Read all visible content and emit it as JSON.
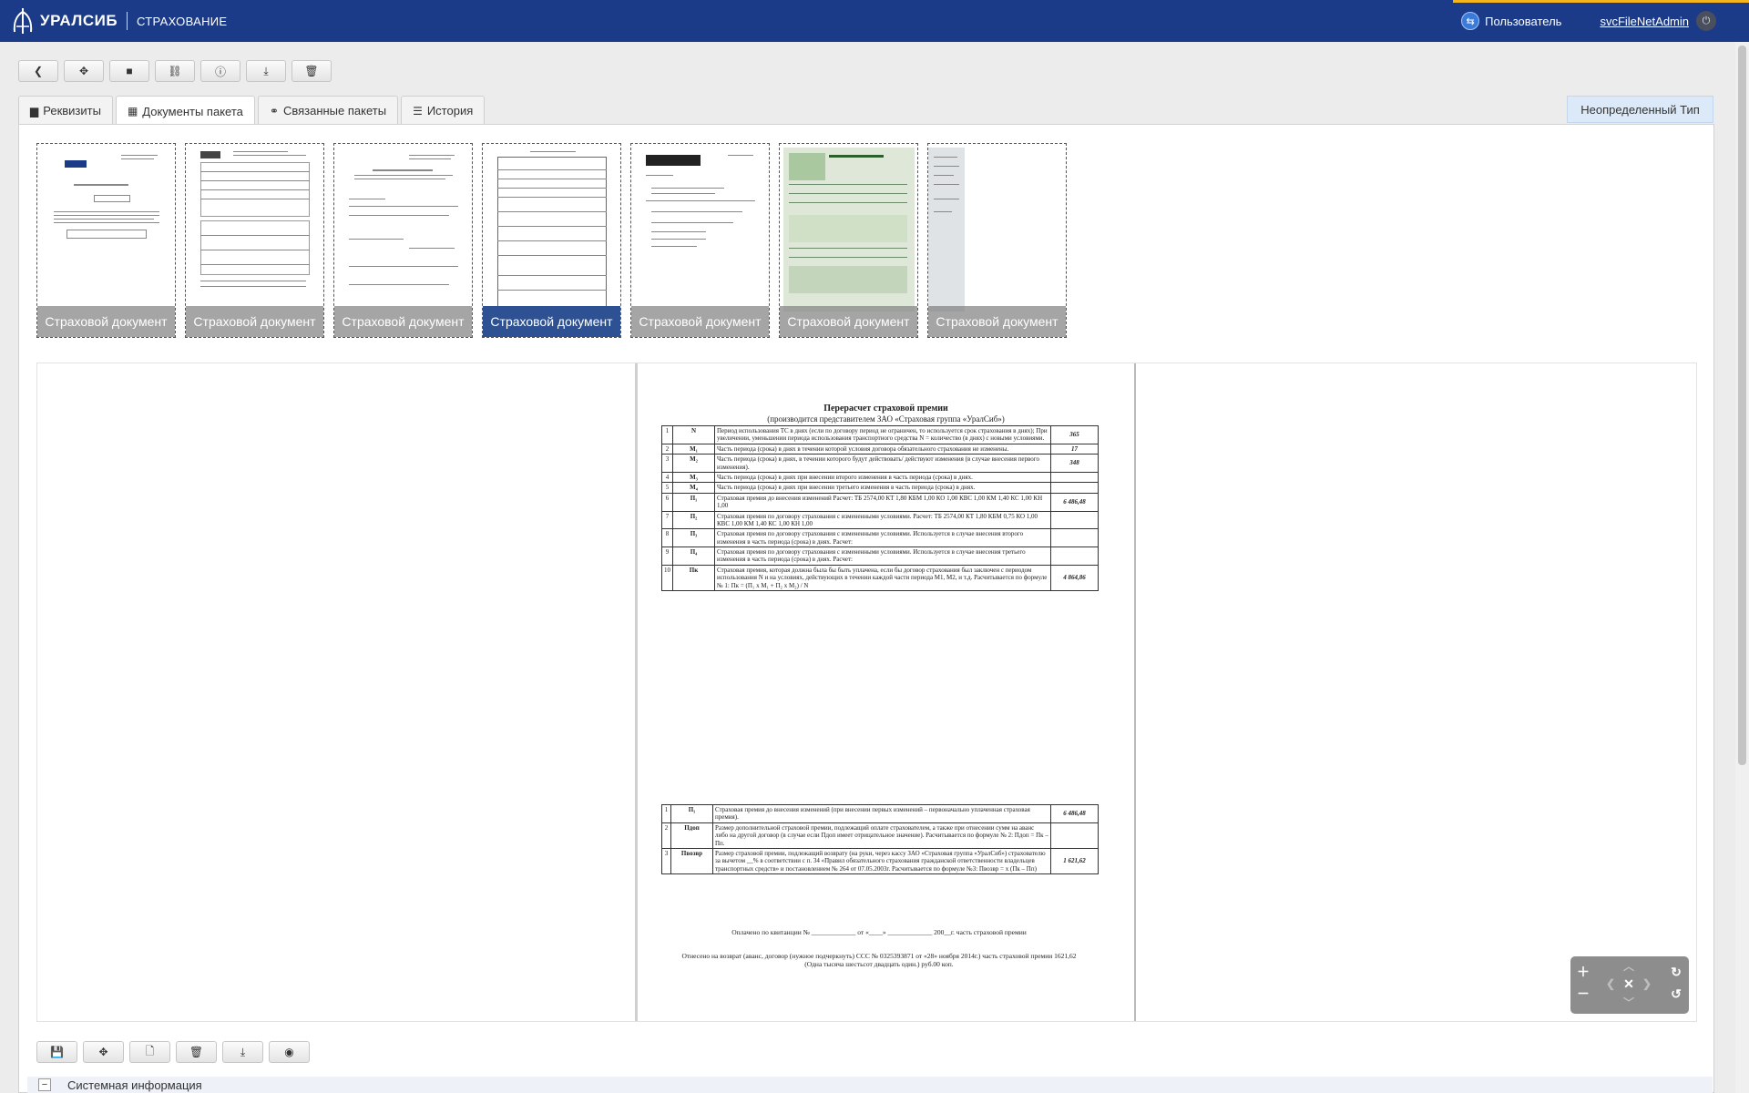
{
  "header": {
    "brand": "УРАЛСИБ",
    "section": "СТРАХОВАНИЕ",
    "role_label": "Пользователь",
    "username": "svcFileNetAdmin"
  },
  "toolbar": {
    "buttons": [
      "back-icon",
      "move-icon",
      "folder-icon",
      "link-icon",
      "info-icon",
      "download-icon",
      "trash-icon"
    ]
  },
  "tabs": [
    {
      "label": "Реквизиты",
      "icon": "book-icon",
      "active": false
    },
    {
      "label": "Документы пакета",
      "icon": "grid-icon",
      "active": true
    },
    {
      "label": "Связанные пакеты",
      "icon": "link-icon",
      "active": false
    },
    {
      "label": "История",
      "icon": "list-icon",
      "active": false
    }
  ],
  "type_badge": "Неопределенный Тип",
  "thumbnails": [
    {
      "caption": "Страховой документ",
      "selected": false
    },
    {
      "caption": "Страховой документ",
      "selected": false
    },
    {
      "caption": "Страховой документ",
      "selected": false
    },
    {
      "caption": "Страховой документ",
      "selected": true
    },
    {
      "caption": "Страховой документ",
      "selected": false
    },
    {
      "caption": "Страховой документ",
      "selected": false
    },
    {
      "caption": "Страховой документ",
      "selected": false
    }
  ],
  "document": {
    "title": "Перерасчет страховой премии",
    "subtitle": "(производится представителем ЗАО «Страховая группа «УралСиб»)",
    "rows": [
      {
        "n": "1",
        "sym": "N",
        "text": "Период использования ТС в днях (если по договору период не ограничен, то используется срок страхования в днях); При увеличении, уменьшении периода использования транспортного средства N = количество (в днях) с новыми условиями.",
        "val": "365"
      },
      {
        "n": "2",
        "sym": "M₁",
        "text": "Часть периода (срока) в днях в течении которой условия договора обязательного страхования не изменены.",
        "val": "17"
      },
      {
        "n": "3",
        "sym": "M₂",
        "text": "Часть периода (срока) в днях, в течении которого будут действовать/ действуют изменения (в случае внесения первого изменения).",
        "val": "348"
      },
      {
        "n": "4",
        "sym": "M₃",
        "text": "Часть периода (срока) в днях при внесении второго изменения в часть периода (срока) в днях.",
        "val": ""
      },
      {
        "n": "5",
        "sym": "M₄",
        "text": "Часть периода (срока) в днях при внесении третьего изменения в часть периода (срока) в днях.",
        "val": ""
      },
      {
        "n": "6",
        "sym": "П₁",
        "text": "Страховая премия до внесения изменений Расчет: ТБ 2574,00 КТ 1,80 КБМ 1,00 КО 1,00 КВС 1,00 КМ 1,40 КС 1,00 КН 1,00",
        "val": "6 486,48"
      },
      {
        "n": "7",
        "sym": "П₂",
        "text": "Страховая премия по договору страхования с измененными условиями. Расчет: ТБ 2574,00 КТ 1,80 КБМ 0,75 КО 1,00 КВС 1,00 КМ 1,40 КС 1,00 КН 1,00",
        "val": ""
      },
      {
        "n": "8",
        "sym": "П₃",
        "text": "Страховая премия по договору страхования с измененными условиями. Используется в случае внесения второго изменения в часть периода (срока) в днях. Расчет:",
        "val": ""
      },
      {
        "n": "9",
        "sym": "П₄",
        "text": "Страховая премия по договору страхования с измененными условиями. Используется в случае внесения третьего изменения в часть периода (срока) в днях. Расчет:",
        "val": ""
      },
      {
        "n": "10",
        "sym": "Пк",
        "text": "Страховая премия, которая должна была бы быть уплачена, если бы договор страхования был заключен с периодом использования N и на условиях, действующих в течении каждой части периода М1, М2, и т.д. Расчитывается по формуле № 1: Пк = (П₁ x M₁ + П₂ x M₂) / N",
        "val": "4 864,86"
      }
    ],
    "rows2": [
      {
        "n": "1",
        "sym": "П₁",
        "text": "Страховая премия до внесения изменений (при внесении первых изменений – первоначально уплаченная страховая премия).",
        "val": "6 486,48"
      },
      {
        "n": "2",
        "sym": "Пдоп",
        "text": "Размер дополнительной страховой премии, подлежащий оплате страхователем, а также при отнесении сумм на аванс либо на другой договор (в случае если Пдоп имеет отрицательное значение). Расчитывается по формуле № 2: Пдоп = Пк – Пп.",
        "val": ""
      },
      {
        "n": "3",
        "sym": "Пвозвр",
        "text": "Размер страховой премии, подлежащий возврату (на руки, через кассу ЗАО «Страховая группа «УралСиб») страхователю за вычетом __% в соответствии с п. 34 «Правил обязательного страхования гражданской ответственности владельцев транспортных средств» и постановлением № 264 от 07.05.2003г. Расчитывается по формуле №3: Пвозвр = x (Пк – Пп)",
        "val": "1 621,62"
      }
    ],
    "note1": "Оплачено по квитанции № _____________ от «____» _____________ 200__г. часть страховой премии",
    "note2": "Отнесено на возврат (аванс, договор (нужное подчеркнуть) ССС № 0325393871 от «28» ноября 2014г.) часть страховой премии 1621,62 (Одна тысяча шестьсот двадцать один.) руб.00 коп."
  },
  "bottom_toolbar": {
    "buttons": [
      "save-icon",
      "move-icon",
      "new-document-icon",
      "trash-icon",
      "download-icon",
      "eye-icon"
    ]
  },
  "system_info": {
    "label": "Системная информация"
  }
}
